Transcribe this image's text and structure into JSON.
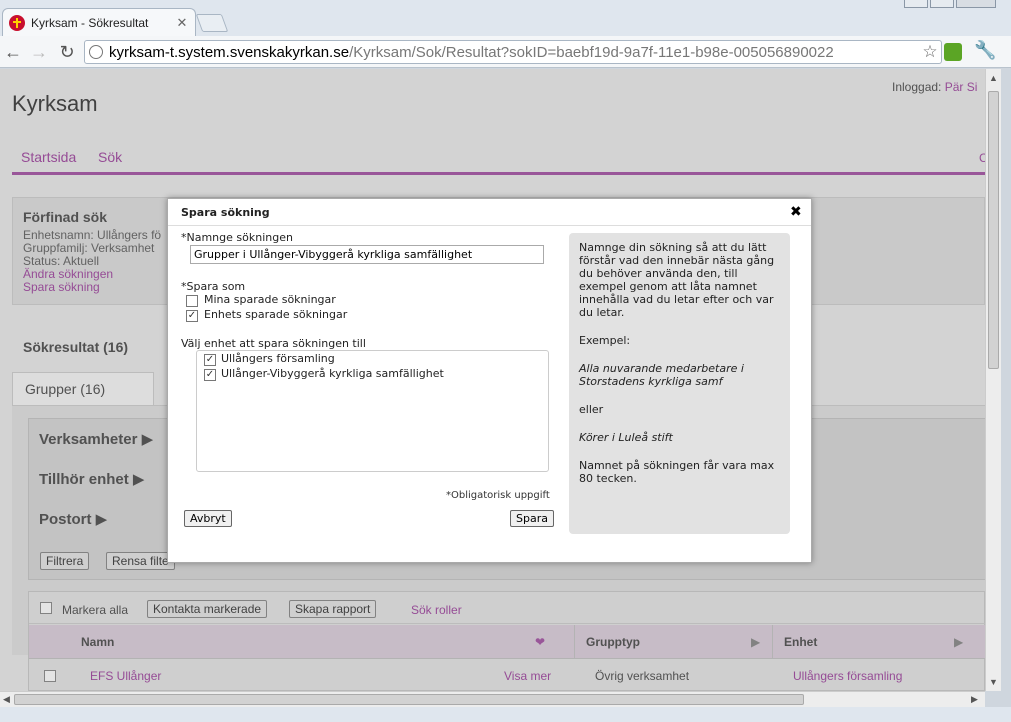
{
  "browser": {
    "tab_title": "Kyrksam - Sökresultat",
    "url_host": "kyrksam-t.system.svenskakyrkan.se",
    "url_path": "/Kyrksam/Sok/Resultat?sokID=baebf19d-9a7f-11e1-b98e-005056890022"
  },
  "app": {
    "title": "Kyrksam",
    "login_label": "Inloggad:",
    "login_user": "Pär Si",
    "nav": [
      "Startsida",
      "Sök"
    ],
    "nav_right": "C"
  },
  "refine": {
    "heading": "Förfinad sök",
    "lines": [
      "Enhetsnamn: Ullångers fö",
      "Gruppfamilj: Verksamhet",
      "Status: Aktuell"
    ],
    "links": [
      "Ändra sökningen",
      "Spara sökning"
    ]
  },
  "results": {
    "title": "Sökresultat (16)",
    "tab": "Grupper (16)",
    "facets": [
      "Verksamheter ▶",
      "Tillhör enhet ▶",
      "Postort ▶"
    ],
    "filter_buttons": [
      "Filtrera",
      "Rensa filte"
    ]
  },
  "table": {
    "select_all": "Markera alla",
    "contact_button": "Kontakta markerade",
    "report_button": "Skapa rapport",
    "roles_link": "Sök roller",
    "headers": [
      "Namn",
      "Grupptyp",
      "Enhet"
    ],
    "rows": [
      {
        "name": "EFS Ullånger",
        "action": "Visa mer",
        "type": "Övrig verksamhet",
        "unit": "Ullångers församling"
      }
    ]
  },
  "dialog": {
    "title": "Spara sökning",
    "name_label": "*Namnge sökningen",
    "name_value": "Grupper i Ullånger-Vibyggerå kyrkliga samfällighet",
    "save_as_label": "*Spara som",
    "save_as_options": [
      {
        "label": "Mina sparade sökningar",
        "checked": false
      },
      {
        "label": "Enhets sparade sökningar",
        "checked": true
      }
    ],
    "unit_label": "Välj enhet att spara sökningen till",
    "units": [
      {
        "label": "Ullångers församling",
        "checked": true
      },
      {
        "label": "Ullånger-Vibyggerå kyrkliga samfällighet",
        "checked": true
      }
    ],
    "required_note": "*Obligatorisk uppgift",
    "cancel": "Avbryt",
    "save": "Spara",
    "help": {
      "intro": "Namnge din sökning så att du lätt förstår vad den innebär nästa gång du behöver använda den, till exempel genom att låta namnet innehålla vad du letar efter och var du letar.",
      "example_label": "Exempel:",
      "example1": "Alla nuvarande medarbetare i Storstadens kyrkliga samf",
      "or": "eller",
      "example2": "Körer i Luleå stift",
      "limit": "Namnet på sökningen får vara max 80 tecken."
    }
  }
}
